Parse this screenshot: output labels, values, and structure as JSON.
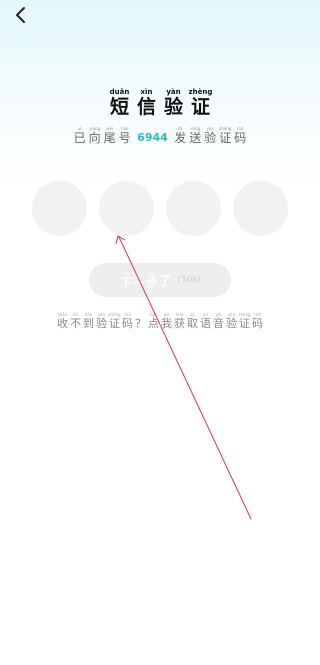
{
  "header": {
    "back_icon": "chevron-left-icon"
  },
  "title": {
    "chars": [
      {
        "py": "duǎn",
        "hz": "短"
      },
      {
        "py": "xìn",
        "hz": "信"
      },
      {
        "py": "yàn",
        "hz": "验"
      },
      {
        "py": "zhèng",
        "hz": "证"
      }
    ]
  },
  "sent_info": {
    "before": [
      {
        "py": "yǐ",
        "hz": "已"
      },
      {
        "py": "xiàng",
        "hz": "向"
      },
      {
        "py": "wěi",
        "hz": "尾"
      },
      {
        "py": "hào",
        "hz": "号"
      }
    ],
    "phone_tail": "6944",
    "after": [
      {
        "py": "fā",
        "hz": "发"
      },
      {
        "py": "sòng",
        "hz": "送"
      },
      {
        "py": "yàn",
        "hz": "验"
      },
      {
        "py": "zhèng",
        "hz": "证"
      },
      {
        "py": "mǎ",
        "hz": "码"
      }
    ]
  },
  "code_inputs": [
    "",
    "",
    "",
    ""
  ],
  "verify_button": {
    "chars": [
      {
        "py": "xià",
        "hz": "下"
      },
      {
        "py": "yī",
        "hz": "一"
      },
      {
        "py": "bù",
        "hz": "步"
      },
      {
        "py": "",
        "hz": "了"
      }
    ],
    "countdown": "(50s)"
  },
  "help": {
    "question": [
      {
        "py": "shōu",
        "hz": "收"
      },
      {
        "py": "bú",
        "hz": "不"
      },
      {
        "py": "dào",
        "hz": "到"
      },
      {
        "py": "yàn",
        "hz": "验"
      },
      {
        "py": "zhèng",
        "hz": "证"
      },
      {
        "py": "mǎ",
        "hz": "码"
      },
      {
        "py": "",
        "hz": "？"
      }
    ],
    "link": [
      {
        "py": "diǎn",
        "hz": "点"
      },
      {
        "py": "wǒ",
        "hz": "我"
      },
      {
        "py": "huò",
        "hz": "获"
      },
      {
        "py": "qǔ",
        "hz": "取"
      },
      {
        "py": "yǔ",
        "hz": "语"
      },
      {
        "py": "yīn",
        "hz": "音"
      },
      {
        "py": "yàn",
        "hz": "验"
      },
      {
        "py": "zhèng",
        "hz": "证"
      },
      {
        "py": "mǎ",
        "hz": "码"
      }
    ]
  },
  "colors": {
    "accent": "#33b9c6",
    "trace": "#e0393e"
  }
}
